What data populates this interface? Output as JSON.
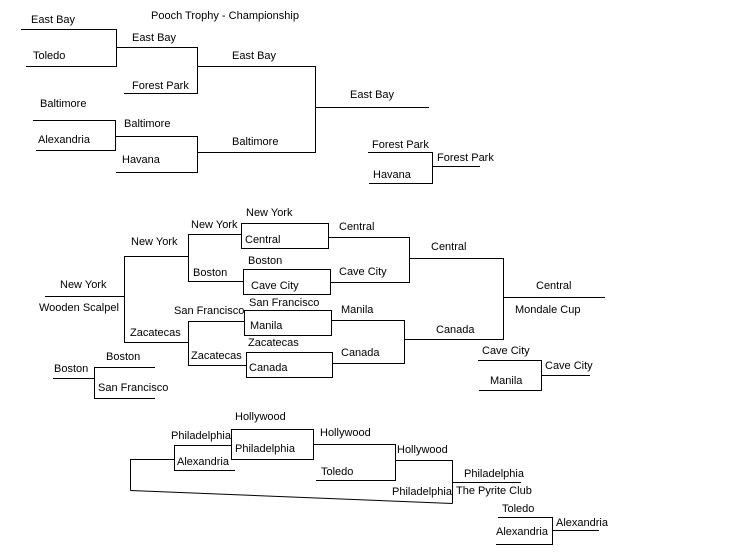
{
  "title": "Pooch Trophy - Championship",
  "colors": {
    "line": "#000000",
    "background": "#ffffff",
    "text": "#000000"
  },
  "championship": {
    "round1": [
      {
        "top": "East Bay",
        "bottom": "Toledo"
      },
      {
        "top": "Baltimore",
        "bottom": "Alexandria"
      }
    ],
    "round2": [
      {
        "top": "East Bay",
        "bottom": "Forest Park"
      },
      {
        "top": "Baltimore",
        "bottom": "Havana"
      }
    ],
    "round3": {
      "top": "East Bay",
      "bottom": "Baltimore"
    },
    "champion": "East Bay",
    "consolation": {
      "top": "Forest Park",
      "bottom": "Havana",
      "winner": "Forest Park"
    }
  },
  "mondale": {
    "name": "Mondale Cup",
    "seed_left": {
      "top": "New York",
      "bottom": "Wooden Scalpel"
    },
    "left_split": {
      "top": "New York",
      "bottom": "Zacatecas"
    },
    "quarter_labels": [
      "New York",
      "Boston",
      "San Francisco",
      "Zacatecas"
    ],
    "boxes": [
      {
        "top": "New York",
        "bottom": "Central"
      },
      {
        "top": "Boston",
        "bottom": "Cave City"
      },
      {
        "top": "San Francisco",
        "bottom": "Manila"
      },
      {
        "top": "Zacatecas",
        "bottom": "Canada"
      }
    ],
    "semis": [
      "Central",
      "Cave City",
      "Manila",
      "Canada"
    ],
    "finals": {
      "top": "Central",
      "bottom": "Canada"
    },
    "champion": "Central",
    "consolation": {
      "top": "Cave City",
      "bottom": "Manila",
      "winner": "Cave City"
    },
    "playin": {
      "seed": "Boston",
      "top": "Boston",
      "bottom": "San Francisco"
    }
  },
  "pyrite": {
    "name": "The Pyrite Club",
    "split": {
      "top": "Philadelphia",
      "bottom": "Alexandria"
    },
    "box": {
      "top": "Hollywood",
      "bottom": "Philadelphia"
    },
    "round2": {
      "top": "Hollywood",
      "bottom": "Toledo"
    },
    "round3": {
      "top": "Hollywood",
      "bottom": "Philadelphia"
    },
    "champion": "Philadelphia",
    "consolation": {
      "top": "Toledo",
      "bottom": "Alexandria",
      "winner": "Alexandria"
    }
  }
}
